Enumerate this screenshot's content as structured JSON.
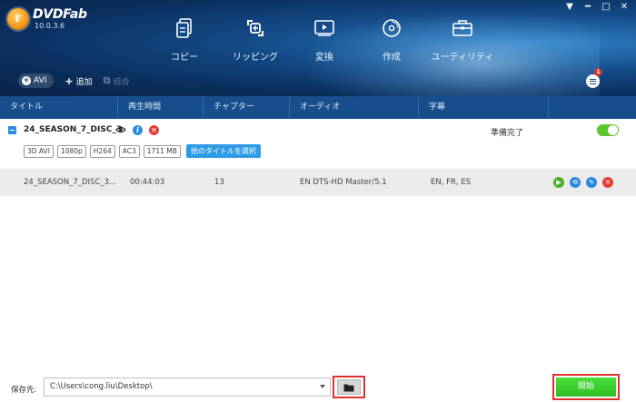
{
  "app": {
    "name": "DVDFab",
    "version": "10.0.3.6"
  },
  "window_controls": {
    "dropdown": "▼",
    "minimize": "━",
    "maximize": "□",
    "close": "✕"
  },
  "nav": [
    {
      "label": "コピー",
      "icon": "copy-icon"
    },
    {
      "label": "リッピング",
      "icon": "ripper-icon"
    },
    {
      "label": "変換",
      "icon": "converter-icon"
    },
    {
      "label": "作成",
      "icon": "creator-icon"
    },
    {
      "label": "ユーティリティ",
      "icon": "utility-icon"
    }
  ],
  "toolbar": {
    "profile": "AVI",
    "add": "追加",
    "merge": "結合",
    "notification_count": "1"
  },
  "columns": [
    "タイトル",
    "再生時間",
    "チャプター",
    "オーディオ",
    "字幕"
  ],
  "title_group": {
    "name": "24_SEASON_7_DISC_3",
    "status": "準備完了",
    "tags": [
      "3D AVI",
      "1080p",
      "H264",
      "AC3",
      "1711 MB"
    ],
    "select_other_title": "他のタイトルを選択"
  },
  "row": {
    "title": "24_SEASON_7_DISC_3...",
    "duration": "00:44:03",
    "chapters": "13",
    "audio": "EN  DTS-HD Master/5.1",
    "subtitles": "EN, FR, ES"
  },
  "footer": {
    "save_label": "保存先:",
    "path": "C:\\Users\\cong.liu\\Desktop\\",
    "start": "開始"
  },
  "colors": {
    "header_dark": "#0b2f5f",
    "column_header": "#174f8e",
    "accent_blue": "#2b8be0",
    "start_green": "#3dd02e",
    "highlight_red": "#e0302c"
  }
}
